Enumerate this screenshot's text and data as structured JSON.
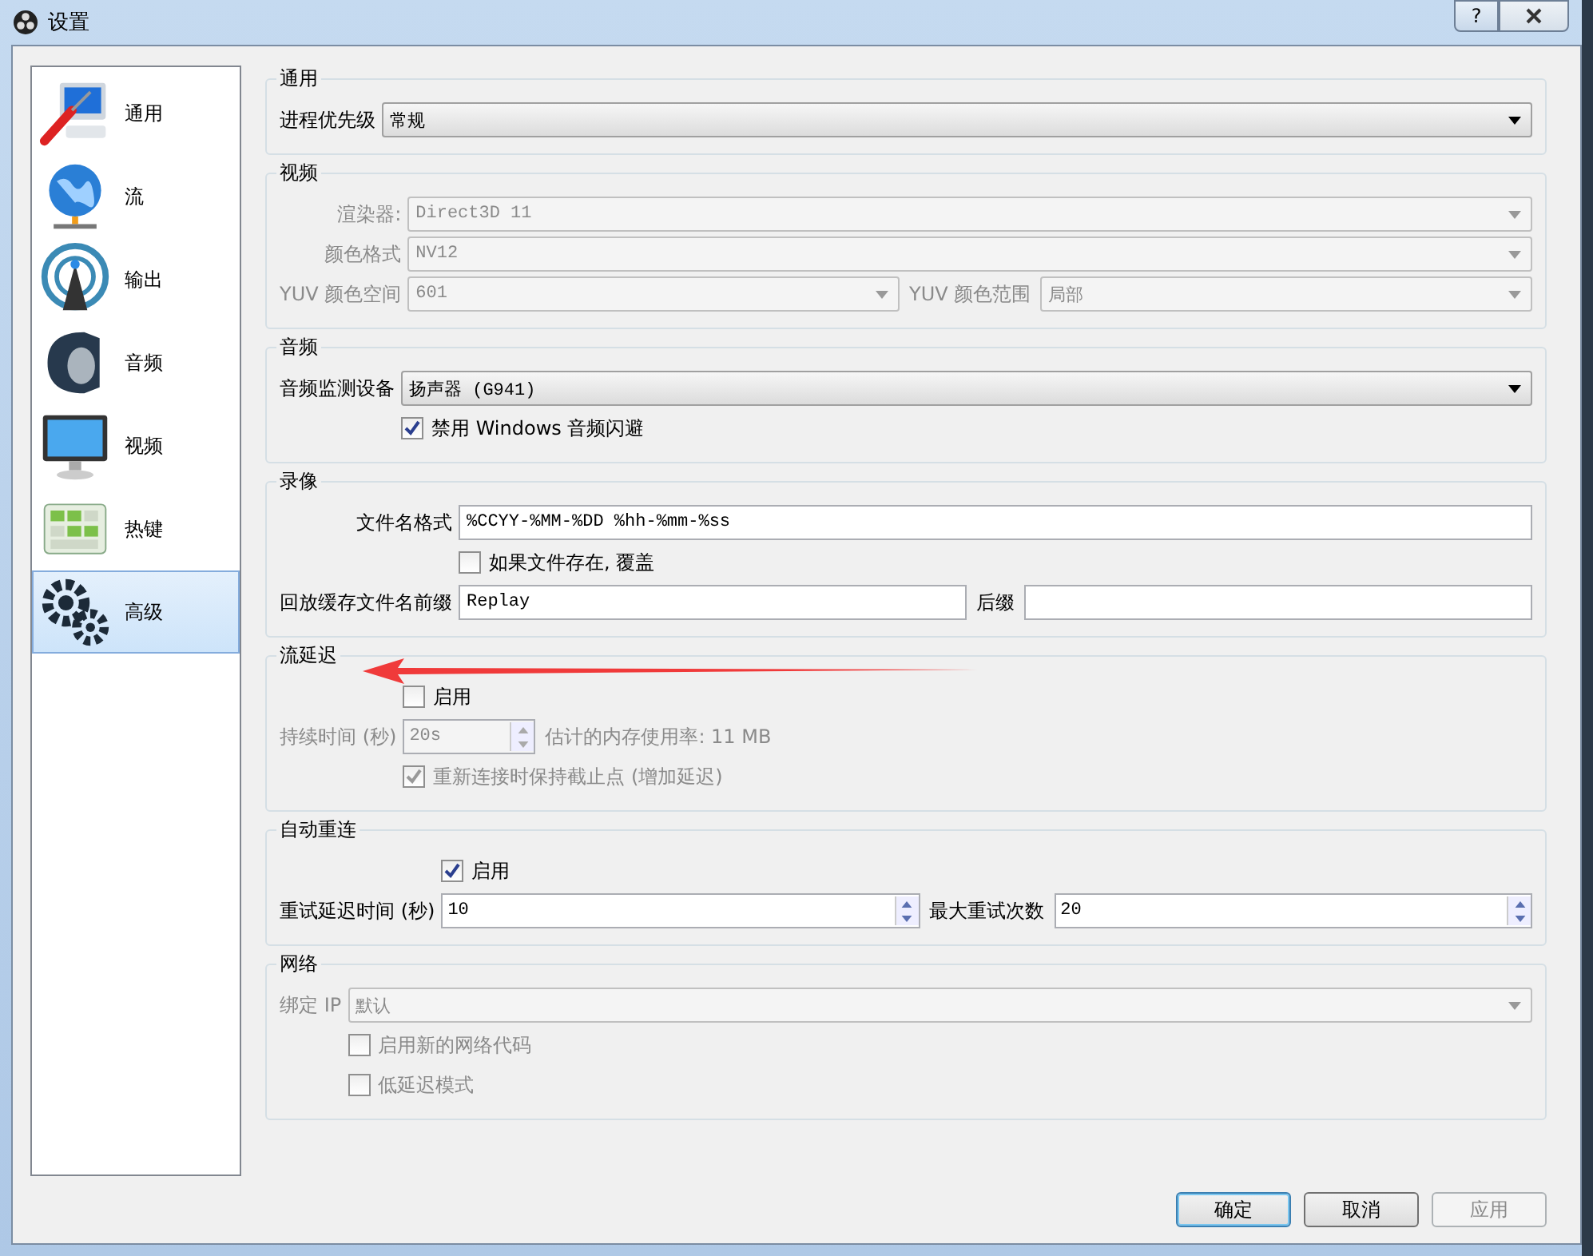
{
  "window": {
    "title": "设置",
    "help": "?"
  },
  "sidebar": {
    "items": [
      {
        "label": "通用",
        "selected": false
      },
      {
        "label": "流",
        "selected": false
      },
      {
        "label": "输出",
        "selected": false
      },
      {
        "label": "音频",
        "selected": false
      },
      {
        "label": "视频",
        "selected": false
      },
      {
        "label": "热键",
        "selected": false
      },
      {
        "label": "高级",
        "selected": true
      }
    ]
  },
  "sections": [
    {
      "title": "通用",
      "rows": [
        {
          "label": "进程优先级",
          "disabled": false,
          "controls": [
            {
              "kind": "select",
              "value": "常规"
            }
          ]
        }
      ]
    },
    {
      "title": "视频",
      "rows": [
        {
          "label": "渲染器:",
          "disabled": true,
          "controls": [
            {
              "kind": "select",
              "value": "Direct3D 11"
            }
          ]
        },
        {
          "label": "颜色格式",
          "disabled": true,
          "controls": [
            {
              "kind": "select",
              "value": "NV12"
            }
          ]
        },
        {
          "label": "YUV 颜色空间",
          "disabled": true,
          "controls": [
            {
              "kind": "select",
              "value": "601"
            },
            {
              "kind": "label",
              "text": "YUV 颜色范围"
            },
            {
              "kind": "select",
              "value": "局部"
            }
          ]
        }
      ]
    },
    {
      "title": "音频",
      "rows": [
        {
          "label": "音频监测设备",
          "disabled": false,
          "controls": [
            {
              "kind": "select",
              "value": "扬声器 (G941)"
            }
          ]
        },
        {
          "disabled": false,
          "controls": [
            {
              "kind": "checkbox",
              "text": "禁用 Windows 音频闪避",
              "checked": true
            }
          ]
        }
      ]
    },
    {
      "title": "录像",
      "rows": [
        {
          "label": "文件名格式",
          "disabled": false,
          "controls": [
            {
              "kind": "input",
              "value": "%CCYY-%MM-%DD %hh-%mm-%ss"
            }
          ]
        },
        {
          "disabled": false,
          "controls": [
            {
              "kind": "checkbox",
              "text": "如果文件存在, 覆盖",
              "checked": false
            }
          ]
        },
        {
          "label": "回放缓存文件名前缀",
          "disabled": false,
          "controls": [
            {
              "kind": "input",
              "value": "Replay"
            },
            {
              "kind": "label",
              "text": "后缀"
            },
            {
              "kind": "input"
            }
          ]
        }
      ]
    },
    {
      "title": "流延迟",
      "rows": [
        {
          "disabled": false,
          "controls": [
            {
              "kind": "checkbox",
              "text": "启用",
              "checked": false
            }
          ]
        },
        {
          "label": "持续时间 (秒)",
          "disabled": true,
          "controls": [
            {
              "kind": "spin",
              "value": "20s"
            },
            {
              "kind": "label",
              "text": "估计的内存使用率: 11 MB"
            }
          ]
        },
        {
          "disabled": true,
          "controls": [
            {
              "kind": "checkbox",
              "text": "重新连接时保持截止点 (增加延迟)",
              "checked": true
            }
          ]
        }
      ]
    },
    {
      "title": "自动重连",
      "rows": [
        {
          "disabled": false,
          "controls": [
            {
              "kind": "checkbox",
              "text": "启用",
              "checked": true
            }
          ]
        },
        {
          "label": "重试延迟时间 (秒)",
          "disabled": false,
          "controls": [
            {
              "kind": "spin",
              "value": "10"
            },
            {
              "kind": "label",
              "text": "最大重试次数"
            },
            {
              "kind": "spin",
              "value": "20"
            }
          ]
        }
      ]
    },
    {
      "title": "网络",
      "rows": [
        {
          "label": "绑定 IP",
          "disabled": true,
          "controls": [
            {
              "kind": "select",
              "value": "默认"
            }
          ]
        },
        {
          "disabled": true,
          "controls": [
            {
              "kind": "checkbox",
              "text": "启用新的网络代码",
              "checked": false
            }
          ]
        },
        {
          "disabled": true,
          "controls": [
            {
              "kind": "checkbox",
              "text": "低延迟模式",
              "checked": false
            }
          ]
        }
      ]
    }
  ],
  "buttons": [
    {
      "label": "确定",
      "default": true,
      "disabled": false
    },
    {
      "label": "取消",
      "default": false,
      "disabled": false
    },
    {
      "label": "应用",
      "default": false,
      "disabled": true
    }
  ]
}
